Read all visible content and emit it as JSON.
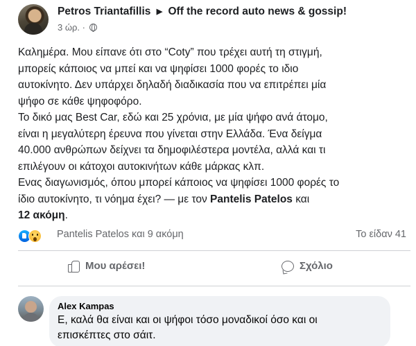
{
  "post": {
    "author": "Petros Triantafillis",
    "arrow": "▶",
    "group": "Off the record auto news & gossip!",
    "time": "3 ώρ.",
    "separator": "·",
    "body_lines": [
      "Καλημέρα. Μου είπανε ότι στο “Coty” που τρέχει αυτή τη στιγμή,",
      "μπορείς κάποιος να μπεί και να ψηφίσει 1000 φορές το ιδιο",
      "αυτοκίνητο. Δεν υπάρχει δηλαδή διαδικασία που να επιτρέπει μία",
      "ψήφο σε κάθε ψηφοφόρο.",
      "Το δικό μας Best Car, εδώ και 25 χρόνια, με μία ψήφο ανά άτομο,",
      "είναι η μεγαλύτερη έρευνα που γίνεται στην Ελλάδα. Ένα δείγμα",
      "40.000 ανθρώπων δείχνει τα δημοφιλέστερα μοντέλα, αλλά και τι",
      "επιλέγουν οι κάτοχοι αυτοκινήτων κάθε μάρκας κλπ.",
      "Ενας διαγωνισμός, όπου μπορεί κάποιος να ψηφίσει 1000 φορές το",
      "ίδιο αυτοκίνητο, τι νόημα έχει?"
    ],
    "tag_prefix": "— με τον",
    "tag_person": "Pantelis Patelos",
    "tag_and": "και",
    "tag_others": "12 ακόμη",
    "tag_end": "."
  },
  "reactions": {
    "names": "Pantelis Patelos και 9 ακόμη",
    "seen": "Το είδαν 41"
  },
  "actions": {
    "like_label": "Μου αρέσει!",
    "comment_label": "Σχόλιο"
  },
  "comment": {
    "author": "Alex Kampas",
    "text_line1": "Ε, καλά θα είναι και οι ψήφοι τόσο μοναδικοί όσο και οι",
    "text_line2": "επισκέπτες στο σάιτ."
  },
  "colors": {
    "text": "#1c1e21",
    "secondary": "#65676b",
    "divider": "#ced0d4",
    "bubble": "#f0f2f5",
    "like_blue": "#1877f2"
  }
}
